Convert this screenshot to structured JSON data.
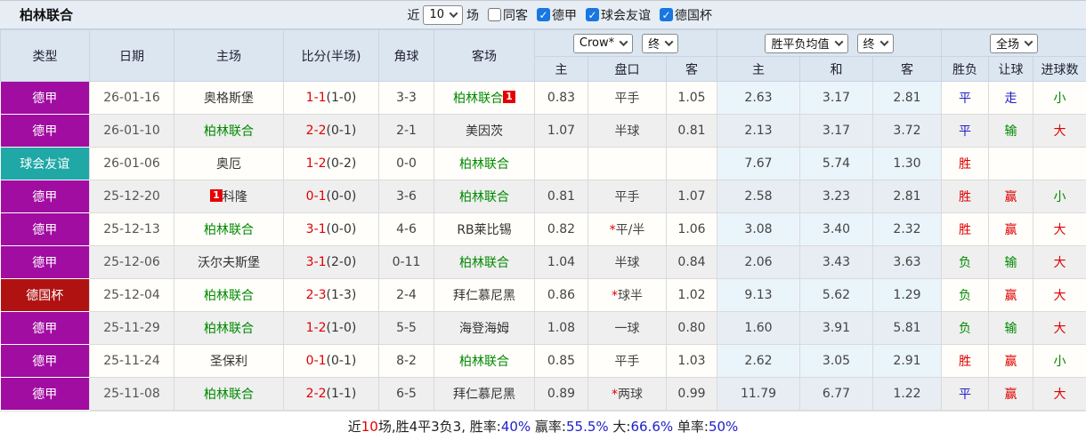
{
  "toolbar": {
    "title": "柏林联合",
    "recent_label": "近",
    "recent_value": "10",
    "matches_label": "场",
    "checkboxes": [
      {
        "label": "同客",
        "checked": false
      },
      {
        "label": "德甲",
        "checked": true
      },
      {
        "label": "球会友谊",
        "checked": true
      },
      {
        "label": "德国杯",
        "checked": true
      }
    ]
  },
  "colors": {
    "red": "#E00000",
    "green": "#008A00",
    "blue": "#2020C8",
    "black": "#222222",
    "focus_team_green": "#008A00",
    "score_red": "#E00000",
    "checkbox_blue": "#1877E0"
  },
  "league_colors": {
    "德甲": "#A10CA1",
    "球会友谊": "#1FA8A6",
    "德国杯": "#B01212"
  },
  "table": {
    "headers": {
      "left": [
        "类型",
        "日期",
        "主场",
        "比分(半场)",
        "角球",
        "客场"
      ],
      "sub": [
        "主",
        "盘口",
        "客",
        "主",
        "和",
        "客",
        "胜负",
        "让球",
        "进球数"
      ]
    },
    "dropdowns": {
      "company": "Crow*",
      "time1": "终",
      "avg": "胜平负均值",
      "time2": "终",
      "scope": "全场"
    },
    "rows": [
      {
        "league": "德甲",
        "date": "26-01-16",
        "home": {
          "name": "奥格斯堡",
          "focus": false,
          "badge": null,
          "badge_pos": null
        },
        "score": "1-1",
        "half": "(1-0)",
        "corner": "3-3",
        "away": {
          "name": "柏林联合",
          "focus": true,
          "badge": "1",
          "badge_pos": "after"
        },
        "asian": {
          "home": "0.83",
          "star": false,
          "handicap": "平手",
          "away": "1.05"
        },
        "euro": {
          "home": "2.63",
          "draw": "3.17",
          "away": "2.81"
        },
        "result": {
          "text": "平",
          "color": "blue"
        },
        "handicap_result": {
          "text": "走",
          "color": "blue"
        },
        "goals": {
          "text": "小",
          "color": "green"
        }
      },
      {
        "league": "德甲",
        "date": "26-01-10",
        "home": {
          "name": "柏林联合",
          "focus": true,
          "badge": null,
          "badge_pos": null
        },
        "score": "2-2",
        "half": "(0-1)",
        "corner": "2-1",
        "away": {
          "name": "美因茨",
          "focus": false,
          "badge": null,
          "badge_pos": null
        },
        "asian": {
          "home": "1.07",
          "star": false,
          "handicap": "半球",
          "away": "0.81"
        },
        "euro": {
          "home": "2.13",
          "draw": "3.17",
          "away": "3.72"
        },
        "result": {
          "text": "平",
          "color": "blue"
        },
        "handicap_result": {
          "text": "输",
          "color": "green"
        },
        "goals": {
          "text": "大",
          "color": "red"
        }
      },
      {
        "league": "球会友谊",
        "date": "26-01-06",
        "home": {
          "name": "奥厄",
          "focus": false,
          "badge": null,
          "badge_pos": null
        },
        "score": "1-2",
        "half": "(0-2)",
        "corner": "0-0",
        "away": {
          "name": "柏林联合",
          "focus": true,
          "badge": null,
          "badge_pos": null
        },
        "asian": {
          "home": "",
          "star": false,
          "handicap": "",
          "away": ""
        },
        "euro": {
          "home": "7.67",
          "draw": "5.74",
          "away": "1.30"
        },
        "result": {
          "text": "胜",
          "color": "red"
        },
        "handicap_result": {
          "text": "",
          "color": "black"
        },
        "goals": {
          "text": "",
          "color": "black"
        }
      },
      {
        "league": "德甲",
        "date": "25-12-20",
        "home": {
          "name": "科隆",
          "focus": false,
          "badge": "1",
          "badge_pos": "before"
        },
        "score": "0-1",
        "half": "(0-0)",
        "corner": "3-6",
        "away": {
          "name": "柏林联合",
          "focus": true,
          "badge": null,
          "badge_pos": null
        },
        "asian": {
          "home": "0.81",
          "star": false,
          "handicap": "平手",
          "away": "1.07"
        },
        "euro": {
          "home": "2.58",
          "draw": "3.23",
          "away": "2.81"
        },
        "result": {
          "text": "胜",
          "color": "red"
        },
        "handicap_result": {
          "text": "赢",
          "color": "red"
        },
        "goals": {
          "text": "小",
          "color": "green"
        }
      },
      {
        "league": "德甲",
        "date": "25-12-13",
        "home": {
          "name": "柏林联合",
          "focus": true,
          "badge": null,
          "badge_pos": null
        },
        "score": "3-1",
        "half": "(0-0)",
        "corner": "4-6",
        "away": {
          "name": "RB莱比锡",
          "focus": false,
          "badge": null,
          "badge_pos": null
        },
        "asian": {
          "home": "0.82",
          "star": true,
          "handicap": "平/半",
          "away": "1.06"
        },
        "euro": {
          "home": "3.08",
          "draw": "3.40",
          "away": "2.32"
        },
        "result": {
          "text": "胜",
          "color": "red"
        },
        "handicap_result": {
          "text": "赢",
          "color": "red"
        },
        "goals": {
          "text": "大",
          "color": "red"
        }
      },
      {
        "league": "德甲",
        "date": "25-12-06",
        "home": {
          "name": "沃尔夫斯堡",
          "focus": false,
          "badge": null,
          "badge_pos": null
        },
        "score": "3-1",
        "half": "(2-0)",
        "corner": "0-11",
        "away": {
          "name": "柏林联合",
          "focus": true,
          "badge": null,
          "badge_pos": null
        },
        "asian": {
          "home": "1.04",
          "star": false,
          "handicap": "半球",
          "away": "0.84"
        },
        "euro": {
          "home": "2.06",
          "draw": "3.43",
          "away": "3.63"
        },
        "result": {
          "text": "负",
          "color": "green"
        },
        "handicap_result": {
          "text": "输",
          "color": "green"
        },
        "goals": {
          "text": "大",
          "color": "red"
        }
      },
      {
        "league": "德国杯",
        "date": "25-12-04",
        "home": {
          "name": "柏林联合",
          "focus": true,
          "badge": null,
          "badge_pos": null
        },
        "score": "2-3",
        "half": "(1-3)",
        "corner": "2-4",
        "away": {
          "name": "拜仁慕尼黑",
          "focus": false,
          "badge": null,
          "badge_pos": null
        },
        "asian": {
          "home": "0.86",
          "star": true,
          "handicap": "球半",
          "away": "1.02"
        },
        "euro": {
          "home": "9.13",
          "draw": "5.62",
          "away": "1.29"
        },
        "result": {
          "text": "负",
          "color": "green"
        },
        "handicap_result": {
          "text": "赢",
          "color": "red"
        },
        "goals": {
          "text": "大",
          "color": "red"
        }
      },
      {
        "league": "德甲",
        "date": "25-11-29",
        "home": {
          "name": "柏林联合",
          "focus": true,
          "badge": null,
          "badge_pos": null
        },
        "score": "1-2",
        "half": "(1-0)",
        "corner": "5-5",
        "away": {
          "name": "海登海姆",
          "focus": false,
          "badge": null,
          "badge_pos": null
        },
        "asian": {
          "home": "1.08",
          "star": false,
          "handicap": "一球",
          "away": "0.80"
        },
        "euro": {
          "home": "1.60",
          "draw": "3.91",
          "away": "5.81"
        },
        "result": {
          "text": "负",
          "color": "green"
        },
        "handicap_result": {
          "text": "输",
          "color": "green"
        },
        "goals": {
          "text": "大",
          "color": "red"
        }
      },
      {
        "league": "德甲",
        "date": "25-11-24",
        "home": {
          "name": "圣保利",
          "focus": false,
          "badge": null,
          "badge_pos": null
        },
        "score": "0-1",
        "half": "(0-1)",
        "corner": "8-2",
        "away": {
          "name": "柏林联合",
          "focus": true,
          "badge": null,
          "badge_pos": null
        },
        "asian": {
          "home": "0.85",
          "star": false,
          "handicap": "平手",
          "away": "1.03"
        },
        "euro": {
          "home": "2.62",
          "draw": "3.05",
          "away": "2.91"
        },
        "result": {
          "text": "胜",
          "color": "red"
        },
        "handicap_result": {
          "text": "赢",
          "color": "red"
        },
        "goals": {
          "text": "小",
          "color": "green"
        }
      },
      {
        "league": "德甲",
        "date": "25-11-08",
        "home": {
          "name": "柏林联合",
          "focus": true,
          "badge": null,
          "badge_pos": null
        },
        "score": "2-2",
        "half": "(1-1)",
        "corner": "6-5",
        "away": {
          "name": "拜仁慕尼黑",
          "focus": false,
          "badge": null,
          "badge_pos": null
        },
        "asian": {
          "home": "0.89",
          "star": true,
          "handicap": "两球",
          "away": "0.99"
        },
        "euro": {
          "home": "11.79",
          "draw": "6.77",
          "away": "1.22"
        },
        "result": {
          "text": "平",
          "color": "blue"
        },
        "handicap_result": {
          "text": "赢",
          "color": "red"
        },
        "goals": {
          "text": "大",
          "color": "red"
        }
      }
    ]
  },
  "footer": {
    "segments": [
      {
        "text": "近",
        "color": "black"
      },
      {
        "text": "10",
        "color": "red"
      },
      {
        "text": "场,胜4平3负3, 胜率:",
        "color": "black"
      },
      {
        "text": "40%",
        "color": "blue"
      },
      {
        "text": " 赢率:",
        "color": "black"
      },
      {
        "text": "55.5%",
        "color": "blue"
      },
      {
        "text": " 大:",
        "color": "black"
      },
      {
        "text": "66.6%",
        "color": "blue"
      },
      {
        "text": " 单率:",
        "color": "black"
      },
      {
        "text": "50%",
        "color": "blue"
      }
    ]
  }
}
